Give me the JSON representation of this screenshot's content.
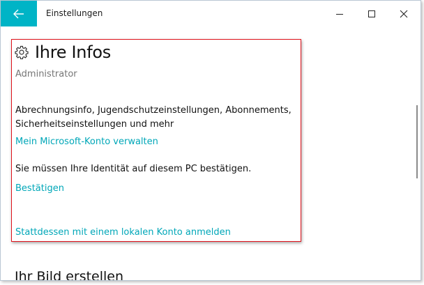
{
  "window": {
    "title": "Einstellungen"
  },
  "titlebar": {
    "back_icon": "arrow-left-icon",
    "accent_color": "#00b4c6",
    "minimize_icon": "minimize-icon",
    "maximize_icon": "maximize-icon",
    "close_icon": "close-icon"
  },
  "info_section": {
    "icon": "gear-icon",
    "heading": "Ihre Infos",
    "account_type": "Administrator",
    "description": "Abrechnungsinfo, Jugendschutzeinstellungen, Abonnements, Sicherheitseinstellungen und mehr",
    "manage_link": "Mein Microsoft-Konto verwalten",
    "verify_text": "Sie müssen Ihre Identität auf diesem PC bestätigen.",
    "verify_link": "Bestätigen",
    "local_account_link": "Stattdessen mit einem lokalen Konto anmelden",
    "highlight_color": "#e0121b",
    "link_color": "#00a7b8"
  },
  "next_section": {
    "heading": "Ihr Bild erstellen"
  }
}
